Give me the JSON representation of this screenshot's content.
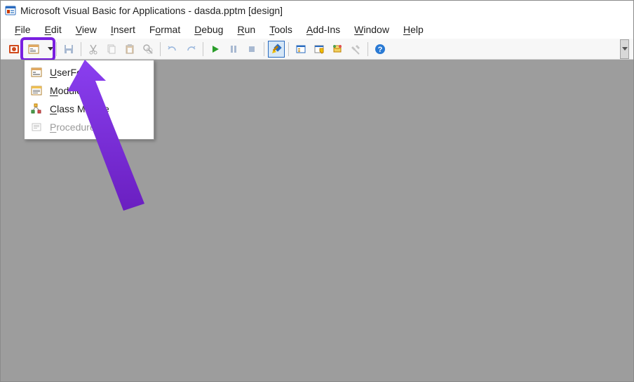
{
  "title": "Microsoft Visual Basic for Applications - dasda.pptm [design]",
  "menubar": {
    "file": "File",
    "edit": "Edit",
    "view": "View",
    "insert": "Insert",
    "format": "Format",
    "debug": "Debug",
    "run": "Run",
    "tools": "Tools",
    "addins": "Add-Ins",
    "window": "Window",
    "help": "Help"
  },
  "toolbar": {
    "view_powerpoint": "view-powerpoint",
    "insert_object": "insert-object",
    "save": "save",
    "cut": "cut",
    "copy": "copy",
    "paste": "paste",
    "find": "find",
    "undo": "undo",
    "redo": "redo",
    "run": "run",
    "break": "break",
    "reset": "reset",
    "design_mode": "design-mode",
    "project_explorer": "project-explorer",
    "properties": "properties",
    "object_browser": "object-browser",
    "toolbox": "toolbox",
    "help": "help"
  },
  "insert_menu": {
    "userform": "UserForm",
    "module": "Module",
    "class_module": "Class Module",
    "procedure": "Procedure..."
  },
  "colors": {
    "highlight": "#7a1fe0",
    "workspace": "#9d9d9d"
  }
}
